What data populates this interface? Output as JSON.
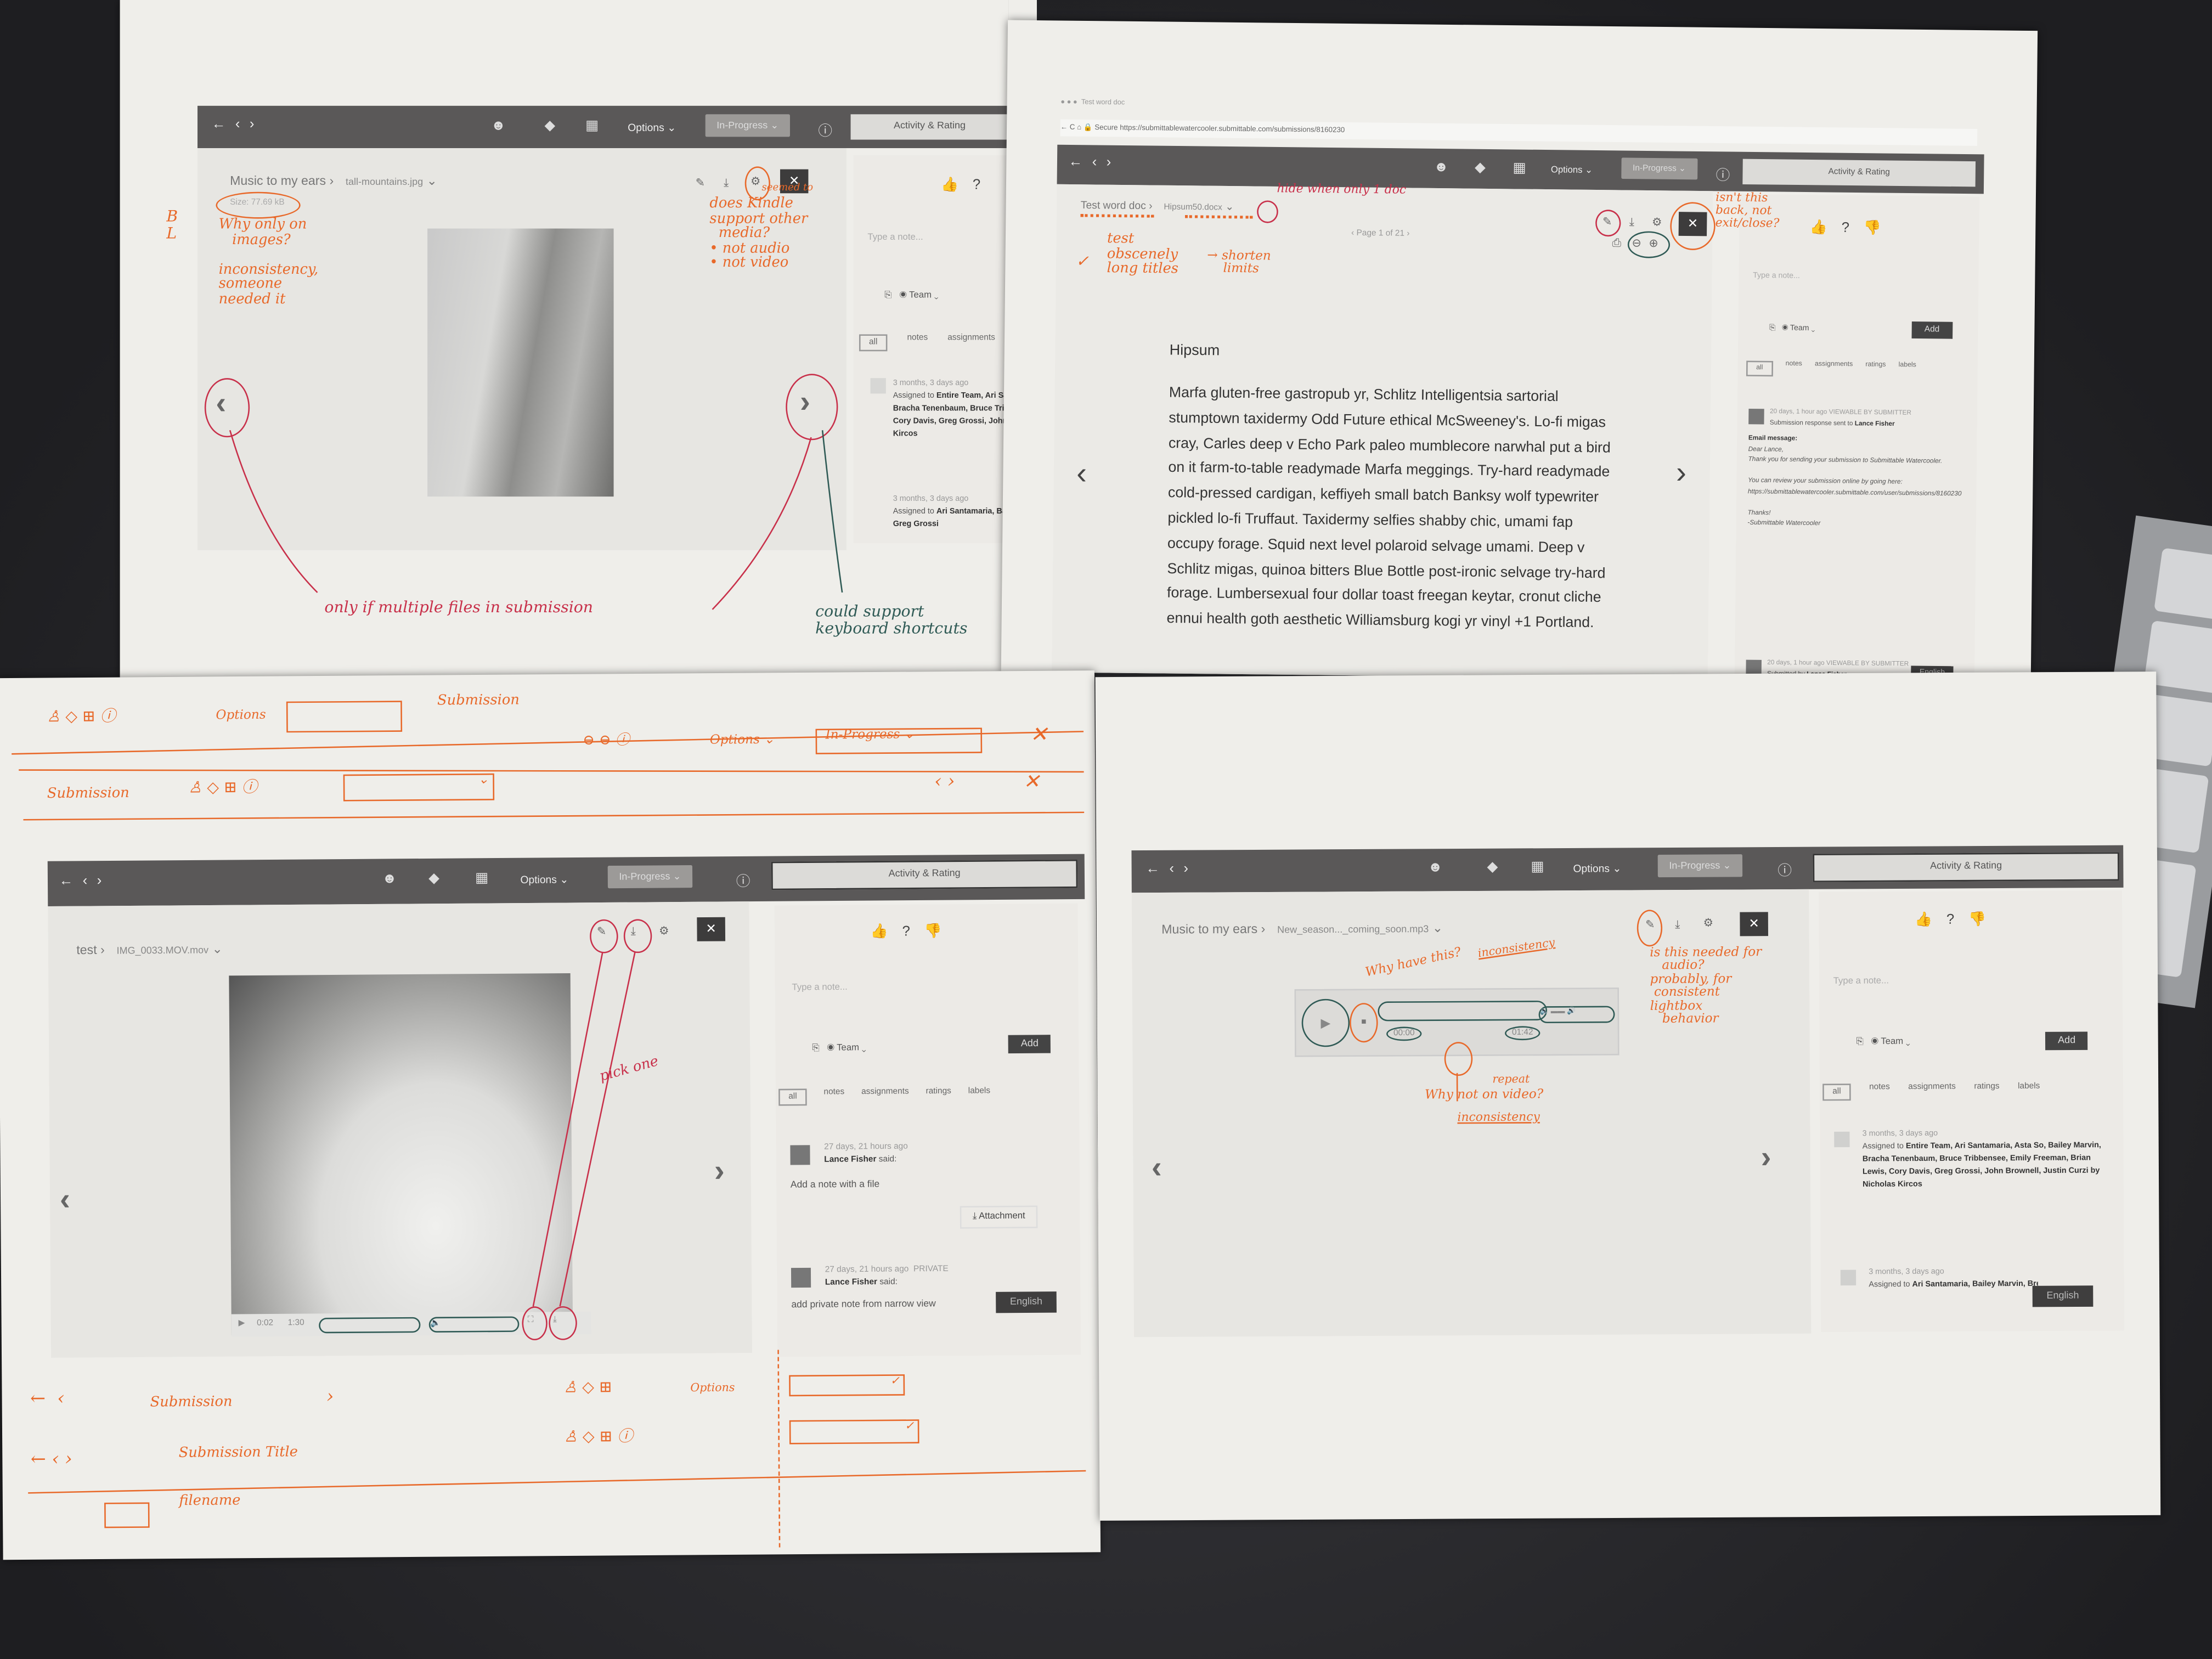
{
  "toolbar": {
    "nav_arrows": "← ‹ ›",
    "options_label": "Options ⌄",
    "status_label": "In-Progress ⌄",
    "activity_tab": "Activity & Rating",
    "note_placeholder": "Type a note...",
    "visibility": "Team",
    "add_label": "Add",
    "filters": [
      "all",
      "notes",
      "assignments",
      "ratings",
      "labels"
    ],
    "language": "English"
  },
  "image_viewer": {
    "submission": "Music to my ears",
    "filename": "tall-mountains.jpg",
    "size": "Size: 77.69 kB",
    "activity": [
      {
        "time": "3 months, 3 days ago",
        "text": "Assigned to",
        "names": "Entire Team, Ari Santamaria, Asta So, Bailey Marvin, Bracha Tenenbaum, Bruce Tribbensee, Emily Freeman, Brian Lewis, Cory Davis, Greg Grossi, John Brownell, Justin Curzi by Nicholas Kircos"
      },
      {
        "time": "3 months, 3 days ago",
        "text": "Assigned to",
        "names": "Ari Santamaria, Bailey Marvin, Brent Maier, Cory Davis, Greg Grossi"
      }
    ]
  },
  "doc_viewer": {
    "browser_tab": "Test word doc",
    "url_secure": "Secure",
    "url": "https://submittablewatercooler.submittable.com/submissions/8160230",
    "submission": "Test word doc",
    "filename": "Hipsum50.docx",
    "pager": "‹ Page 1 of 21 ›",
    "doc_title": "Hipsum",
    "doc_body": "Marfa gluten-free gastropub yr, Schlitz Intelligentsia sartorial stumptown taxidermy Odd Future ethical McSweeney's. Lo-fi migas cray, Carles deep v Echo Park paleo mumblecore narwhal put a bird on it farm-to-table readymade Marfa meggings. Try-hard readymade cold-pressed cardigan, keffiyeh small batch Banksy wolf typewriter pickled lo-fi Truffaut. Taxidermy selfies shabby chic, umami fap occupy forage. Squid next level polaroid selvage umami. Deep v Schlitz migas, quinoa bitters Blue Bottle post-ironic selvage try-hard forage. Lumbersexual four dollar toast freegan keytar, cronut cliche ennui health goth aesthetic Williamsburg kogi yr vinyl +1 Portland.",
    "activity": [
      {
        "time": "20 days, 1 hour ago",
        "badge": "VIEWABLE BY SUBMITTER",
        "text": "Submission response sent to",
        "name": "Lance Fisher",
        "email_heading": "Email message:",
        "email_body": "Dear Lance,\nThank you for sending your submission to Submittable Watercooler.\n\nYou can review your submission online by going here:\nhttps://submittablewatercooler.submittable.com/user/submissions/8160230\n\nThanks!\n-Submittable Watercooler"
      },
      {
        "time": "20 days, 1 hour ago",
        "badge": "VIEWABLE BY SUBMITTER",
        "text": "Submitted by",
        "name": "Lance Fisher"
      }
    ]
  },
  "video_viewer": {
    "submission": "test",
    "filename": "IMG_0033.MOV.mov",
    "time_current": "0:02",
    "time_total": "1:30",
    "activity": [
      {
        "time": "27 days, 21 hours ago",
        "badge": "",
        "name": "Lance Fisher",
        "said": "said:",
        "text": "Add a note with a file",
        "attachment": "Attachment"
      },
      {
        "time": "27 days, 21 hours ago",
        "badge": "PRIVATE",
        "name": "Lance Fisher",
        "said": "said:",
        "text": "add private note from narrow view"
      }
    ]
  },
  "audio_viewer": {
    "submission": "Music to my ears",
    "filename": "New_season..._coming_soon.mp3",
    "time_current": "00:00",
    "time_total": "01:42"
  },
  "annotations": {
    "size_note": "Why only on\n   images?\n\ninconsistency,\nsomeone\nneeded it",
    "bl": "B\nL",
    "kindle_note": "does Kindle\nsupport other\n  media?\n• not audio\n• not video",
    "kindle_seemed": "seemed to",
    "multiple_files": "only if multiple files in submission",
    "keyboard": "could support\nkeyboard shortcuts",
    "hide_doc": "hide when only 1 doc",
    "long_titles": "test\nobscenely\nlong titles",
    "shorten": "→ shorten\n    limits",
    "back_exit": "isn't this\nback, not\nexit/close?",
    "pick_one": "pick one",
    "why_have": "Why have this?",
    "inconsistency_1": "inconsistency",
    "needed_audio": "is this needed for\n   audio?\nprobably, for\n consistent\nlightbox\n   behavior",
    "repeat": "repeat",
    "why_not_video": "Why not on video?",
    "inconsistency_2": "inconsistency"
  },
  "sketches": {
    "row1_options": "Options",
    "row1_submission": "Submission",
    "row2_options": "Options ⌄",
    "row2_status": "In-Progress ⌄",
    "row3_submission": "Submission",
    "bottom_row1": "Submission",
    "bottom_row1_options": "Options",
    "bottom_row2": "Submission Title",
    "bottom_filename": "filename"
  },
  "colors": {
    "annotation_orange": "#e8692a",
    "annotation_red": "#c8304a",
    "annotation_green": "#2f5a55",
    "toolbar": "#5a5858"
  }
}
